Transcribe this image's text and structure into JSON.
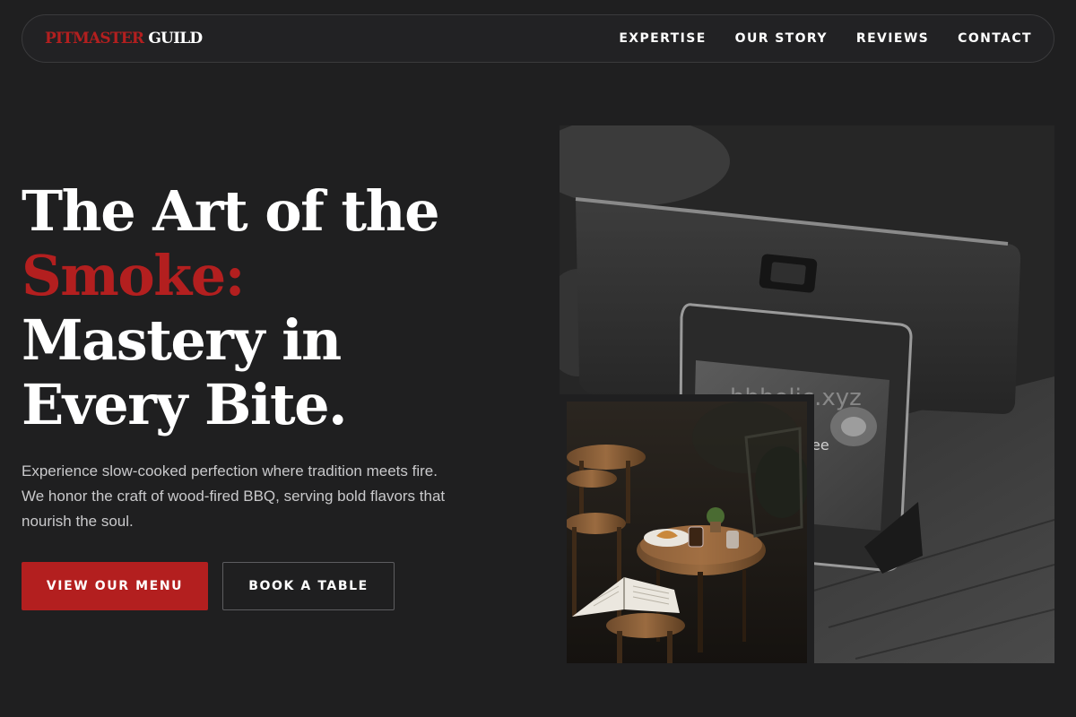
{
  "brand": {
    "name_accent": "PITMASTER",
    "name_main": "GUILD"
  },
  "nav": {
    "items": [
      {
        "label": "EXPERTISE"
      },
      {
        "label": "OUR STORY"
      },
      {
        "label": "REVIEWS"
      },
      {
        "label": "CONTACT"
      }
    ]
  },
  "hero": {
    "title_line1": "The Art of the",
    "title_accent": "Smoke:",
    "title_line3": "Mastery in",
    "title_line4": "Every Bite.",
    "description": "Experience slow-cooked perfection where tradition meets fire. We honor the craft of wood-fired BBQ, serving bold flavors that nourish the soul.",
    "primary_button": "VIEW OUR MENU",
    "secondary_button": "BOOK A TABLE"
  },
  "images": {
    "main_watermark": "hbholic.xyz",
    "main_screen_text": "ffee"
  },
  "colors": {
    "accent": "#b31f1f",
    "background": "#1f1f20",
    "text": "#ffffff",
    "muted_text": "#c9c9cb"
  }
}
